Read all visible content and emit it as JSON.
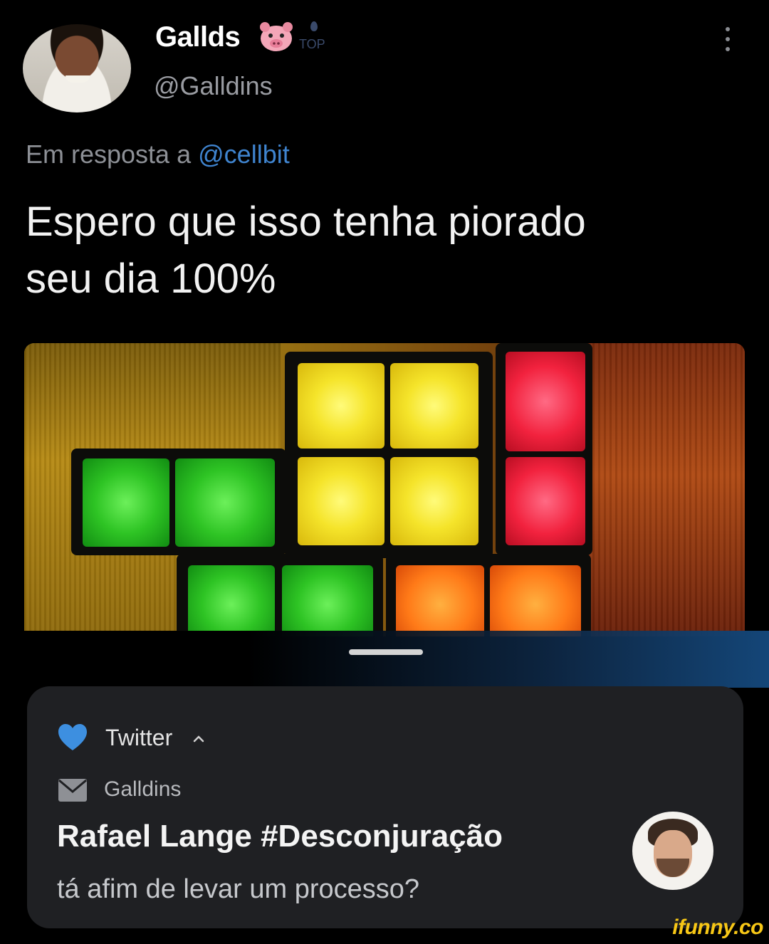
{
  "tweet": {
    "display_name": "Gallds",
    "badge_text": "TOP",
    "handle": "@Galldins",
    "reply_prefix": "Em resposta a",
    "reply_mention": "@cellbit",
    "text_line1": "Espero que isso tenha piorado",
    "text_line2": "seu dia 100%"
  },
  "notification": {
    "app_name": "Twitter",
    "sender": "Galldins",
    "title": "Rafael Lange #Desconjuração",
    "body": "tá afim de levar um processo?"
  },
  "watermark": "ifunny.co",
  "colors": {
    "mention_blue": "#3f84cf",
    "heart_blue": "#3d8fe0",
    "watermark_yellow": "#f7c716",
    "card_bg": "#1f2023"
  },
  "icons": [
    "pig-emoji-icon",
    "more-vert-icon",
    "heart-icon",
    "chevron-up-icon",
    "mail-icon"
  ]
}
